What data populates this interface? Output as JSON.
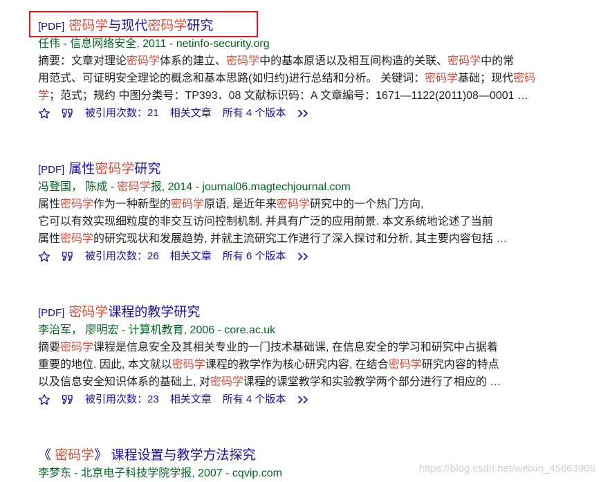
{
  "results": [
    {
      "pdf_tag": "[PDF]",
      "title": [
        {
          "t": "密码学",
          "h": true
        },
        {
          "t": "与现代",
          "h": false
        },
        {
          "t": "密码学",
          "h": true
        },
        {
          "t": "研究",
          "h": false
        }
      ],
      "meta": [
        {
          "t": "任伟 - 信息网络安全, 2011 - netinfo-security.org",
          "h": false
        }
      ],
      "snippet": [
        [
          {
            "t": "摘要：文章对理论",
            "h": false
          },
          {
            "t": "密码学",
            "h": true
          },
          {
            "t": "体系的建立、",
            "h": false
          },
          {
            "t": "密码学",
            "h": true
          },
          {
            "t": "中的基本原语以及相互间构造的关联、",
            "h": false
          },
          {
            "t": "密码学",
            "h": true
          },
          {
            "t": "中的常",
            "h": false
          }
        ],
        [
          {
            "t": "用范式、可证明安全理论的概念和基本思路(如归约)进行总结和分析。 关键词：",
            "h": false
          },
          {
            "t": "密码学",
            "h": true
          },
          {
            "t": "基础；现代",
            "h": false
          },
          {
            "t": "密码",
            "h": true
          }
        ],
        [
          {
            "t": "学",
            "h": true
          },
          {
            "t": "；范式；规约 中图分类号：TP393．08 文献标识码：A 文章编号：1671—1122(2011)08—0001 …",
            "h": false
          }
        ]
      ],
      "cited": "被引用次数：21",
      "related": "相关文章",
      "versions": "所有 4 个版本"
    },
    {
      "pdf_tag": "[PDF]",
      "title": [
        {
          "t": "属性",
          "h": false
        },
        {
          "t": "密码学",
          "h": true
        },
        {
          "t": "研究",
          "h": false
        }
      ],
      "meta": [
        {
          "t": "冯登国， 陈成 - ",
          "h": false
        },
        {
          "t": "密码学",
          "h": true
        },
        {
          "t": "报, 2014 - journal06.magtechjournal.com",
          "h": false
        }
      ],
      "snippet": [
        [
          {
            "t": "属性",
            "h": false
          },
          {
            "t": "密码学",
            "h": true
          },
          {
            "t": "作为一种新型的",
            "h": false
          },
          {
            "t": "密码学",
            "h": true
          },
          {
            "t": "原语, 是近年来",
            "h": false
          },
          {
            "t": "密码学",
            "h": true
          },
          {
            "t": "研究中的一个热门方向,",
            "h": false
          }
        ],
        [
          {
            "t": "它可以有效实现细粒度的非交互访问控制机制, 并具有广泛的应用前景. 本文系统地论述了当前",
            "h": false
          }
        ],
        [
          {
            "t": "属性",
            "h": false
          },
          {
            "t": "密码学",
            "h": true
          },
          {
            "t": "的研究现状和发展趋势, 并就主流研究工作进行了深入探讨和分析, 其主要内容包括 …",
            "h": false
          }
        ]
      ],
      "cited": "被引用次数：26",
      "related": "相关文章",
      "versions": "所有 6 个版本"
    },
    {
      "pdf_tag": "[PDF]",
      "title": [
        {
          "t": "密码学",
          "h": true
        },
        {
          "t": "课程的教学研究",
          "h": false
        }
      ],
      "meta": [
        {
          "t": "李治军， 廖明宏 - 计算机教育, 2006 - core.ac.uk",
          "h": false
        }
      ],
      "snippet": [
        [
          {
            "t": "摘要",
            "h": false
          },
          {
            "t": "密码学",
            "h": true
          },
          {
            "t": "课程是信息安全及其相关专业的一门技术基础课, 在信息安全的学习和研究中占据着",
            "h": false
          }
        ],
        [
          {
            "t": "重要的地位. 因此, 本文就以",
            "h": false
          },
          {
            "t": "密码学",
            "h": true
          },
          {
            "t": "课程的教学作为核心研究内容, 在结合",
            "h": false
          },
          {
            "t": "密码学",
            "h": true
          },
          {
            "t": "研究内容的特点",
            "h": false
          }
        ],
        [
          {
            "t": "以及信息安全知识体系的基础上, 对",
            "h": false
          },
          {
            "t": "密码学",
            "h": true
          },
          {
            "t": "课程的课堂教学和实验教学两个部分进行了相应的 …",
            "h": false
          }
        ]
      ],
      "cited": "被引用次数：23",
      "related": "相关文章",
      "versions": "所有 4 个版本"
    },
    {
      "pdf_tag": "",
      "title": [
        {
          "t": "《 ",
          "h": false
        },
        {
          "t": "密码学",
          "h": true
        },
        {
          "t": "》 课程设置与教学方法探究",
          "h": false
        }
      ],
      "meta": [
        {
          "t": "李梦东 - 北京电子科技学院学报, 2007 - cqvip.com",
          "h": false
        }
      ],
      "snippet": [],
      "cited": "",
      "related": "",
      "versions": ""
    }
  ],
  "watermark": "https://blog.csdn.net/weixin_45663905",
  "colors": {
    "link": "#1a0dab",
    "highlight": "#dd4b39",
    "meta": "#006621",
    "frame": "#e8141c"
  },
  "icons": [
    "star-icon",
    "quote-icon",
    "double-chevron-icon"
  ]
}
